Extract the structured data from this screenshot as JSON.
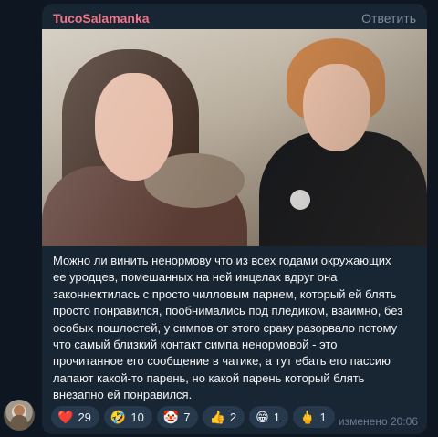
{
  "message": {
    "sender": "TucoSalamanka",
    "reply_label": "Ответить",
    "text_lines": [
      "Можно ли винить ненормову что из всех годами окружающих",
      "ее уродцев, помешанных на ней инцелах вдруг она",
      "законнектилась с просто чилловым парнем, который ей блять",
      "просто понравился, пообнимались под пледиком, взаимно, без",
      "особых пошлостей, у симпов от этого сраку разорвало потому",
      "что самый близкий контакт симпа ненормовой - это",
      "прочитанное его сообщение в чатике, а тут ебать его пассию",
      "лапают какой-то парень, но какой парень который блять",
      "внезапно ей понравился."
    ],
    "edited_label": "изменено 20:06",
    "sender_color": "#f27388",
    "reactions": [
      {
        "emoji": "❤️",
        "icon": "heart-icon",
        "count": "29"
      },
      {
        "emoji": "🤣",
        "icon": "rofl-icon",
        "count": "10"
      },
      {
        "emoji": "🤡",
        "icon": "clown-icon",
        "count": "7"
      },
      {
        "emoji": "👍",
        "icon": "thumbs-up-icon",
        "count": "2"
      },
      {
        "emoji": "😁",
        "icon": "grin-icon",
        "count": "1"
      },
      {
        "emoji": "🖕",
        "icon": "middle-finger-icon",
        "count": "1"
      }
    ]
  }
}
